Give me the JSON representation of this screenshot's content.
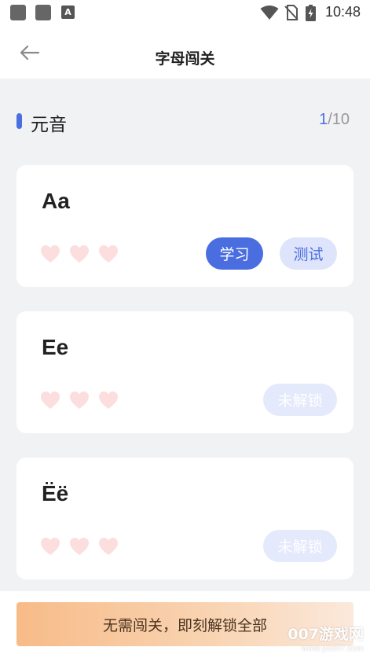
{
  "status_bar": {
    "time": "10:48",
    "a_icon_label": "A",
    "icons": [
      "square-notification-icon",
      "square-notification-icon",
      "a-badge-icon",
      "wifi-icon",
      "no-sim-icon",
      "battery-charging-icon"
    ]
  },
  "nav": {
    "back_icon": "arrow-left-icon",
    "title": "字母闯关"
  },
  "section": {
    "title": "元音",
    "progress_current": "1",
    "progress_total": "/10",
    "accent_color": "#4a6fe0"
  },
  "cards": [
    {
      "letter": "Aa",
      "hearts": 3,
      "learn_label": "学习",
      "test_label": "测试"
    },
    {
      "letter": "Ee",
      "hearts": 3,
      "locked_label": "未解锁"
    },
    {
      "letter": "Ëë",
      "hearts": 3,
      "locked_label": "未解锁"
    }
  ],
  "bottom": {
    "unlock_all_label": "无需闯关，即刻解锁全部",
    "watermark_main": "007游戏网",
    "watermark_url": "www.yx007.com"
  },
  "colors": {
    "primary": "#4a6ee0",
    "heart": "#fcdede",
    "locked_button": "#e4e9fc",
    "gradient_start": "#f7bb88",
    "gradient_end": "#fbe9dc"
  }
}
